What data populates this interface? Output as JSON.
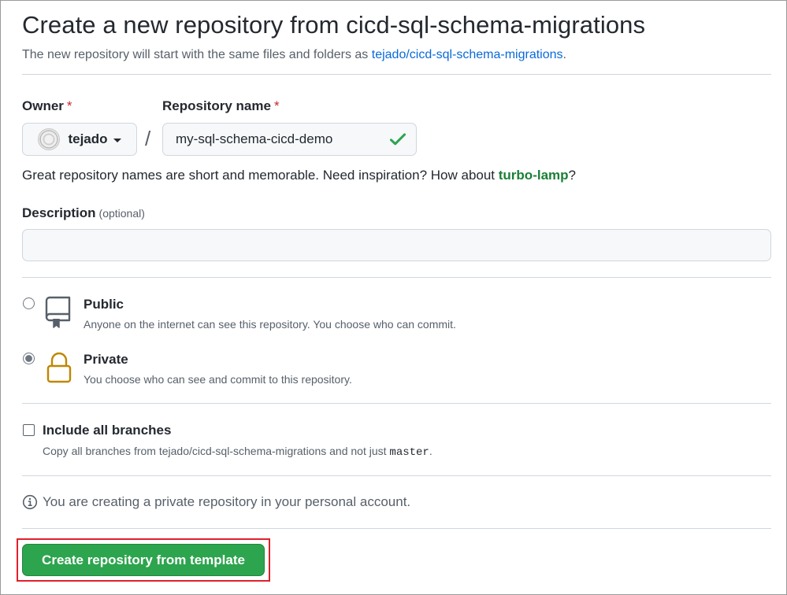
{
  "header": {
    "title": "Create a new repository from cicd-sql-schema-migrations",
    "subtitle_prefix": "The new repository will start with the same files and folders as ",
    "subtitle_link": "tejado/cicd-sql-schema-migrations",
    "subtitle_suffix": "."
  },
  "owner": {
    "label": "Owner",
    "required_mark": "*",
    "selected": "tejado"
  },
  "repo_name": {
    "label": "Repository name",
    "required_mark": "*",
    "value": "my-sql-schema-cicd-demo",
    "separator": "/"
  },
  "hint": {
    "prefix": "Great repository names are short and memorable. Need inspiration? How about ",
    "suggestion": "turbo-lamp",
    "suffix": "?"
  },
  "description": {
    "label": "Description",
    "optional": "(optional)",
    "value": ""
  },
  "visibility": {
    "public": {
      "title": "Public",
      "desc": "Anyone on the internet can see this repository. You choose who can commit.",
      "checked": false
    },
    "private": {
      "title": "Private",
      "desc": "You choose who can see and commit to this repository.",
      "checked": true
    }
  },
  "branches": {
    "title": "Include all branches",
    "desc_prefix": "Copy all branches from tejado/cicd-sql-schema-migrations and not just ",
    "desc_code": "master",
    "desc_suffix": "."
  },
  "info": {
    "text": "You are creating a private repository in your personal account."
  },
  "submit": {
    "label": "Create repository from template"
  },
  "colors": {
    "primary_button": "#2da44e",
    "link": "#0969da",
    "suggestion": "#1a7f37",
    "required": "#cf222e",
    "private_icon": "#bf8700",
    "highlight_box": "#e0202a"
  }
}
